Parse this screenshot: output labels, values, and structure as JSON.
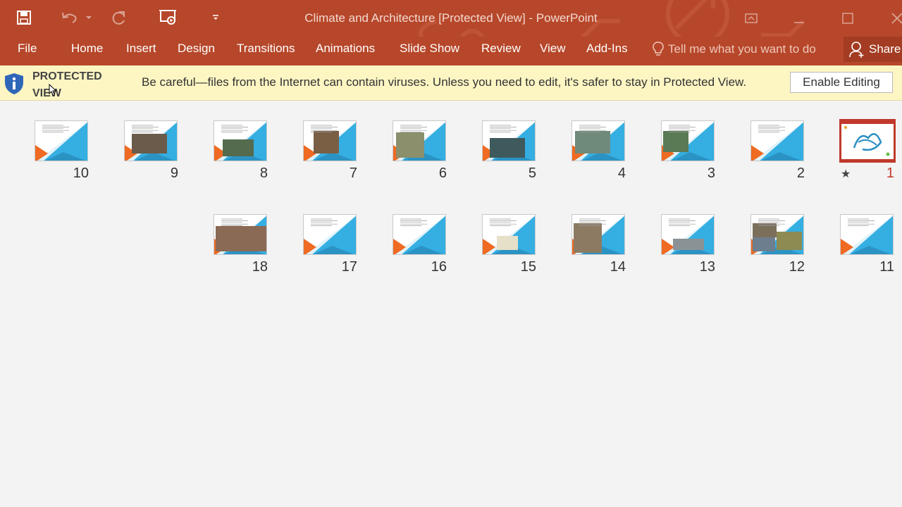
{
  "window": {
    "title": "Climate and Architecture [Protected View] - PowerPoint"
  },
  "ribbon": {
    "tabs": [
      "File",
      "Home",
      "Insert",
      "Design",
      "Transitions",
      "Animations",
      "Slide Show",
      "Review",
      "View",
      "Add-Ins"
    ],
    "tell_me": "Tell me what you want to do",
    "share": "Share"
  },
  "protected_view": {
    "title": "PROTECTED VIEW",
    "message": "Be careful—files from the Internet can contain viruses. Unless you need to edit, it's safer to stay in Protected View.",
    "button": "Enable Editing"
  },
  "slides": {
    "row1": [
      "10",
      "9",
      "8",
      "7",
      "6",
      "5",
      "4",
      "3",
      "2",
      "1"
    ],
    "row2": [
      "18",
      "17",
      "16",
      "15",
      "14",
      "13",
      "12",
      "11"
    ],
    "selected": "1"
  },
  "colors": {
    "accent": "#b7472a",
    "slide_blue": "#35aee2",
    "slide_orange": "#ef6a22",
    "selected_border": "#c0392b"
  }
}
